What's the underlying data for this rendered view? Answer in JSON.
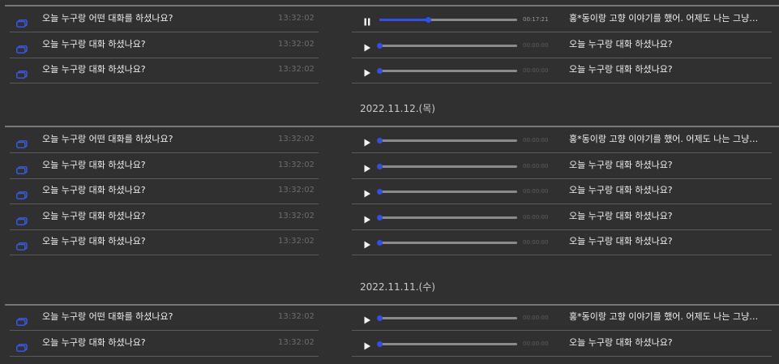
{
  "colors": {
    "background": "#303030",
    "accent_blue": "#2f52e0",
    "text": "#f0f0f0",
    "muted": "#6c6c6c",
    "divider": "#5a5a5a"
  },
  "groups": [
    {
      "date": "",
      "rows": [
        {
          "question": "오늘 누구랑 어떤 대화를 하셨나요?",
          "time": "13:32:02",
          "state": "pause",
          "progress": 0.35,
          "duration": "00:17:21",
          "answer": "홍*동이랑 고향 이야기를 했어. 어제도 나는 그냥 너…"
        },
        {
          "question": "오늘 누구랑 대화 하셨나요?",
          "time": "13:32:02",
          "state": "play",
          "progress": 0,
          "duration": "00:00:00",
          "answer": "오늘 누구랑 대화 하셨나요?"
        },
        {
          "question": "오늘 누구랑 대화 하셨나요?",
          "time": "13:32:02",
          "state": "play",
          "progress": 0,
          "duration": "00:00:00",
          "answer": "오늘 누구랑 대화 하셨나요?"
        }
      ]
    },
    {
      "date": "2022.11.12.(목)",
      "rows": [
        {
          "question": "오늘 누구랑 어떤 대화를 하셨나요?",
          "time": "13:32:02",
          "state": "play",
          "progress": 0,
          "duration": "00:00:00",
          "answer": "홍*동이랑 고향 이야기를 했어. 어제도 나는 그냥 너…"
        },
        {
          "question": "오늘 누구랑 대화 하셨나요?",
          "time": "13:32:02",
          "state": "play",
          "progress": 0,
          "duration": "00:00:00",
          "answer": "오늘 누구랑 대화 하셨나요?"
        },
        {
          "question": "오늘 누구랑 대화 하셨나요?",
          "time": "13:32:02",
          "state": "play",
          "progress": 0,
          "duration": "00:00:00",
          "answer": "오늘 누구랑 대화 하셨나요?"
        },
        {
          "question": "오늘 누구랑 대화 하셨나요?",
          "time": "13:32:02",
          "state": "play",
          "progress": 0,
          "duration": "00:00:00",
          "answer": "오늘 누구랑 대화 하셨나요?"
        },
        {
          "question": "오늘 누구랑 대화 하셨나요?",
          "time": "13:32:02",
          "state": "play",
          "progress": 0,
          "duration": "00:00:00",
          "answer": "오늘 누구랑 대화 하셨나요?"
        }
      ]
    },
    {
      "date": "2022.11.11.(수)",
      "rows": [
        {
          "question": "오늘 누구랑 어떤 대화를 하셨나요?",
          "time": "13:32:02",
          "state": "play",
          "progress": 0,
          "duration": "00:00:00",
          "answer": "홍*동이랑 고향 이야기를 했어. 어제도 나는 그냥 너…"
        },
        {
          "question": "오늘 누구랑 대화 하셨나요?",
          "time": "13:32:02",
          "state": "play",
          "progress": 0,
          "duration": "00:00:00",
          "answer": "오늘 누구랑 대화 하셨나요?"
        }
      ]
    }
  ]
}
